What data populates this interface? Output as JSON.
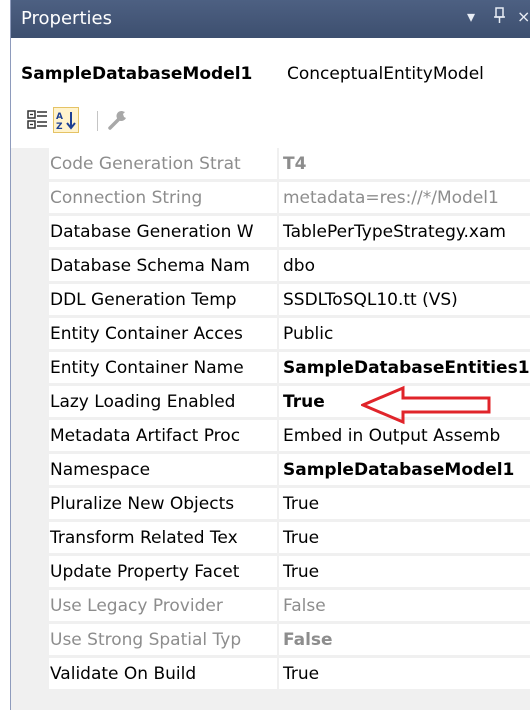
{
  "window": {
    "title": "Properties",
    "dropdown_glyph": "▾",
    "pin_glyph": "ᵖ",
    "close_glyph": "×"
  },
  "object": {
    "name": "SampleDatabaseModel1",
    "type": "ConceptualEntityModel"
  },
  "toolbar": {
    "categorized_icon": "categorized-icon",
    "alphabetical_icon": "alphabetical-sort-icon",
    "property_pages_icon": "wrench-icon"
  },
  "properties": [
    {
      "name": "Code Generation Strat",
      "value": "T4"
    },
    {
      "name": "Connection String",
      "value": "metadata=res://*/Model1"
    },
    {
      "name": "Database Generation W",
      "value": "TablePerTypeStrategy.xam"
    },
    {
      "name": "Database Schema Nam",
      "value": "dbo"
    },
    {
      "name": "DDL Generation Temp",
      "value": "SSDLToSQL10.tt (VS)"
    },
    {
      "name": "Entity Container Acces",
      "value": "Public"
    },
    {
      "name": "Entity Container Name",
      "value": "SampleDatabaseEntities1"
    },
    {
      "name": "Lazy Loading Enabled",
      "value": "True"
    },
    {
      "name": "Metadata Artifact Proc",
      "value": "Embed in Output Assemb"
    },
    {
      "name": "Namespace",
      "value": "SampleDatabaseModel1"
    },
    {
      "name": "Pluralize New Objects",
      "value": "True"
    },
    {
      "name": "Transform Related Tex",
      "value": "True"
    },
    {
      "name": "Update Property Facet",
      "value": "True"
    },
    {
      "name": "Use Legacy Provider",
      "value": "False"
    },
    {
      "name": "Use Strong Spatial Typ",
      "value": "False"
    },
    {
      "name": "Validate On Build",
      "value": "True"
    }
  ],
  "annotation": {
    "arrow_color": "#e0242a"
  }
}
